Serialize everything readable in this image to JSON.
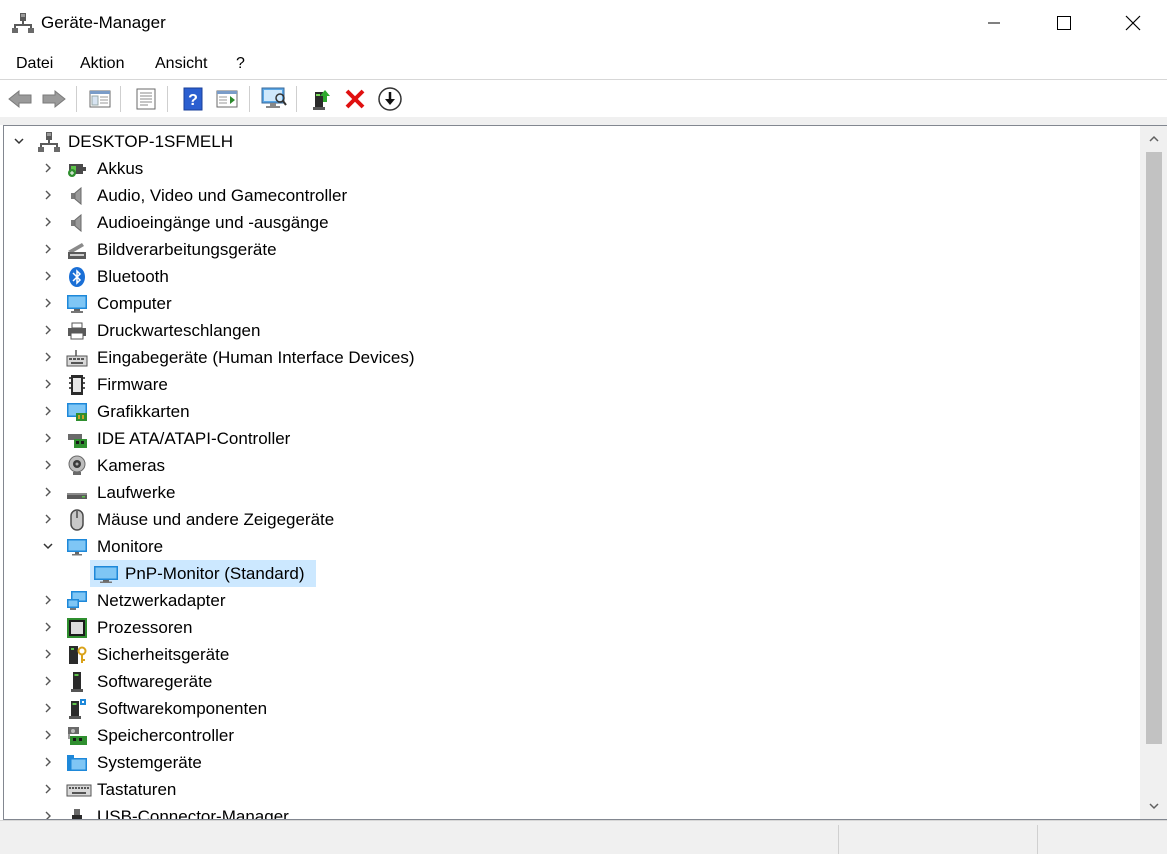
{
  "window": {
    "title": "Geräte-Manager"
  },
  "menu": {
    "items": [
      "Datei",
      "Aktion",
      "Ansicht",
      "?"
    ]
  },
  "toolbar": {
    "icons": [
      "back-icon",
      "forward-icon",
      "show-hide-console-tree-icon",
      "properties-icon",
      "help-icon",
      "action-pane-icon",
      "scan-hardware-icon",
      "update-driver-icon",
      "uninstall-icon",
      "disable-device-icon"
    ]
  },
  "tree": {
    "root": "DESKTOP-1SFMELH",
    "categories": [
      {
        "label": "Akkus",
        "icon": "battery-icon",
        "expanded": false
      },
      {
        "label": "Audio, Video und Gamecontroller",
        "icon": "speaker-icon",
        "expanded": false
      },
      {
        "label": "Audioeingänge und -ausgänge",
        "icon": "speaker-icon",
        "expanded": false
      },
      {
        "label": "Bildverarbeitungsgeräte",
        "icon": "scanner-icon",
        "expanded": false
      },
      {
        "label": "Bluetooth",
        "icon": "bluetooth-icon",
        "expanded": false
      },
      {
        "label": "Computer",
        "icon": "computer-icon",
        "expanded": false
      },
      {
        "label": "Druckwarteschlangen",
        "icon": "printer-icon",
        "expanded": false
      },
      {
        "label": "Eingabegeräte (Human Interface Devices)",
        "icon": "hid-icon",
        "expanded": false
      },
      {
        "label": "Firmware",
        "icon": "firmware-icon",
        "expanded": false
      },
      {
        "label": "Grafikkarten",
        "icon": "display-adapter-icon",
        "expanded": false
      },
      {
        "label": "IDE ATA/ATAPI-Controller",
        "icon": "ide-controller-icon",
        "expanded": false
      },
      {
        "label": "Kameras",
        "icon": "camera-icon",
        "expanded": false
      },
      {
        "label": "Laufwerke",
        "icon": "disk-drive-icon",
        "expanded": false
      },
      {
        "label": "Mäuse und andere Zeigegeräte",
        "icon": "mouse-icon",
        "expanded": false
      },
      {
        "label": "Monitore",
        "icon": "monitor-icon",
        "expanded": true
      },
      {
        "label": "Netzwerkadapter",
        "icon": "network-adapter-icon",
        "expanded": false
      },
      {
        "label": "Prozessoren",
        "icon": "processor-icon",
        "expanded": false
      },
      {
        "label": "Sicherheitsgeräte",
        "icon": "security-device-icon",
        "expanded": false
      },
      {
        "label": "Softwaregeräte",
        "icon": "software-device-icon",
        "expanded": false
      },
      {
        "label": "Softwarekomponenten",
        "icon": "software-component-icon",
        "expanded": false
      },
      {
        "label": "Speichercontroller",
        "icon": "storage-controller-icon",
        "expanded": false
      },
      {
        "label": "Systemgeräte",
        "icon": "system-device-icon",
        "expanded": false
      },
      {
        "label": "Tastaturen",
        "icon": "keyboard-icon",
        "expanded": false
      },
      {
        "label": "USB-Connector-Manager",
        "icon": "usb-icon",
        "expanded": false
      }
    ],
    "monitor_children": [
      "PnP-Monitor (Standard)"
    ],
    "selected": "PnP-Monitor (Standard)"
  },
  "colors": {
    "selection": "#cce8ff",
    "monitor_blue": "#1e88d9",
    "uninstall_red": "#e01010"
  }
}
